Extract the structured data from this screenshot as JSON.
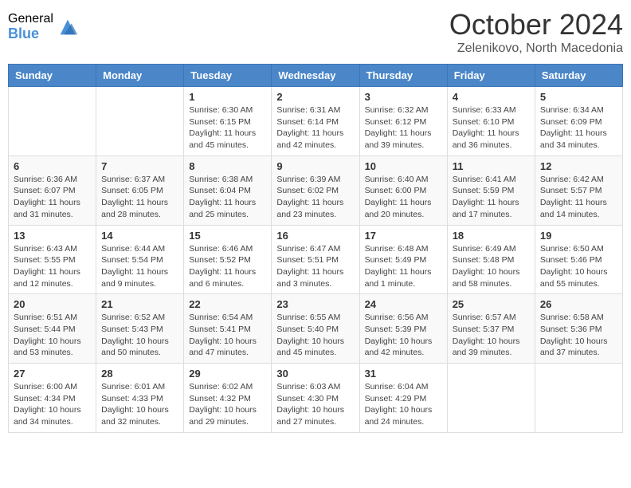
{
  "logo": {
    "general": "General",
    "blue": "Blue"
  },
  "header": {
    "month": "October 2024",
    "location": "Zelenikovo, North Macedonia"
  },
  "weekdays": [
    "Sunday",
    "Monday",
    "Tuesday",
    "Wednesday",
    "Thursday",
    "Friday",
    "Saturday"
  ],
  "weeks": [
    [
      {
        "day": "",
        "info": ""
      },
      {
        "day": "",
        "info": ""
      },
      {
        "day": "1",
        "info": "Sunrise: 6:30 AM\nSunset: 6:15 PM\nDaylight: 11 hours and 45 minutes."
      },
      {
        "day": "2",
        "info": "Sunrise: 6:31 AM\nSunset: 6:14 PM\nDaylight: 11 hours and 42 minutes."
      },
      {
        "day": "3",
        "info": "Sunrise: 6:32 AM\nSunset: 6:12 PM\nDaylight: 11 hours and 39 minutes."
      },
      {
        "day": "4",
        "info": "Sunrise: 6:33 AM\nSunset: 6:10 PM\nDaylight: 11 hours and 36 minutes."
      },
      {
        "day": "5",
        "info": "Sunrise: 6:34 AM\nSunset: 6:09 PM\nDaylight: 11 hours and 34 minutes."
      }
    ],
    [
      {
        "day": "6",
        "info": "Sunrise: 6:36 AM\nSunset: 6:07 PM\nDaylight: 11 hours and 31 minutes."
      },
      {
        "day": "7",
        "info": "Sunrise: 6:37 AM\nSunset: 6:05 PM\nDaylight: 11 hours and 28 minutes."
      },
      {
        "day": "8",
        "info": "Sunrise: 6:38 AM\nSunset: 6:04 PM\nDaylight: 11 hours and 25 minutes."
      },
      {
        "day": "9",
        "info": "Sunrise: 6:39 AM\nSunset: 6:02 PM\nDaylight: 11 hours and 23 minutes."
      },
      {
        "day": "10",
        "info": "Sunrise: 6:40 AM\nSunset: 6:00 PM\nDaylight: 11 hours and 20 minutes."
      },
      {
        "day": "11",
        "info": "Sunrise: 6:41 AM\nSunset: 5:59 PM\nDaylight: 11 hours and 17 minutes."
      },
      {
        "day": "12",
        "info": "Sunrise: 6:42 AM\nSunset: 5:57 PM\nDaylight: 11 hours and 14 minutes."
      }
    ],
    [
      {
        "day": "13",
        "info": "Sunrise: 6:43 AM\nSunset: 5:55 PM\nDaylight: 11 hours and 12 minutes."
      },
      {
        "day": "14",
        "info": "Sunrise: 6:44 AM\nSunset: 5:54 PM\nDaylight: 11 hours and 9 minutes."
      },
      {
        "day": "15",
        "info": "Sunrise: 6:46 AM\nSunset: 5:52 PM\nDaylight: 11 hours and 6 minutes."
      },
      {
        "day": "16",
        "info": "Sunrise: 6:47 AM\nSunset: 5:51 PM\nDaylight: 11 hours and 3 minutes."
      },
      {
        "day": "17",
        "info": "Sunrise: 6:48 AM\nSunset: 5:49 PM\nDaylight: 11 hours and 1 minute."
      },
      {
        "day": "18",
        "info": "Sunrise: 6:49 AM\nSunset: 5:48 PM\nDaylight: 10 hours and 58 minutes."
      },
      {
        "day": "19",
        "info": "Sunrise: 6:50 AM\nSunset: 5:46 PM\nDaylight: 10 hours and 55 minutes."
      }
    ],
    [
      {
        "day": "20",
        "info": "Sunrise: 6:51 AM\nSunset: 5:44 PM\nDaylight: 10 hours and 53 minutes."
      },
      {
        "day": "21",
        "info": "Sunrise: 6:52 AM\nSunset: 5:43 PM\nDaylight: 10 hours and 50 minutes."
      },
      {
        "day": "22",
        "info": "Sunrise: 6:54 AM\nSunset: 5:41 PM\nDaylight: 10 hours and 47 minutes."
      },
      {
        "day": "23",
        "info": "Sunrise: 6:55 AM\nSunset: 5:40 PM\nDaylight: 10 hours and 45 minutes."
      },
      {
        "day": "24",
        "info": "Sunrise: 6:56 AM\nSunset: 5:39 PM\nDaylight: 10 hours and 42 minutes."
      },
      {
        "day": "25",
        "info": "Sunrise: 6:57 AM\nSunset: 5:37 PM\nDaylight: 10 hours and 39 minutes."
      },
      {
        "day": "26",
        "info": "Sunrise: 6:58 AM\nSunset: 5:36 PM\nDaylight: 10 hours and 37 minutes."
      }
    ],
    [
      {
        "day": "27",
        "info": "Sunrise: 6:00 AM\nSunset: 4:34 PM\nDaylight: 10 hours and 34 minutes."
      },
      {
        "day": "28",
        "info": "Sunrise: 6:01 AM\nSunset: 4:33 PM\nDaylight: 10 hours and 32 minutes."
      },
      {
        "day": "29",
        "info": "Sunrise: 6:02 AM\nSunset: 4:32 PM\nDaylight: 10 hours and 29 minutes."
      },
      {
        "day": "30",
        "info": "Sunrise: 6:03 AM\nSunset: 4:30 PM\nDaylight: 10 hours and 27 minutes."
      },
      {
        "day": "31",
        "info": "Sunrise: 6:04 AM\nSunset: 4:29 PM\nDaylight: 10 hours and 24 minutes."
      },
      {
        "day": "",
        "info": ""
      },
      {
        "day": "",
        "info": ""
      }
    ]
  ]
}
